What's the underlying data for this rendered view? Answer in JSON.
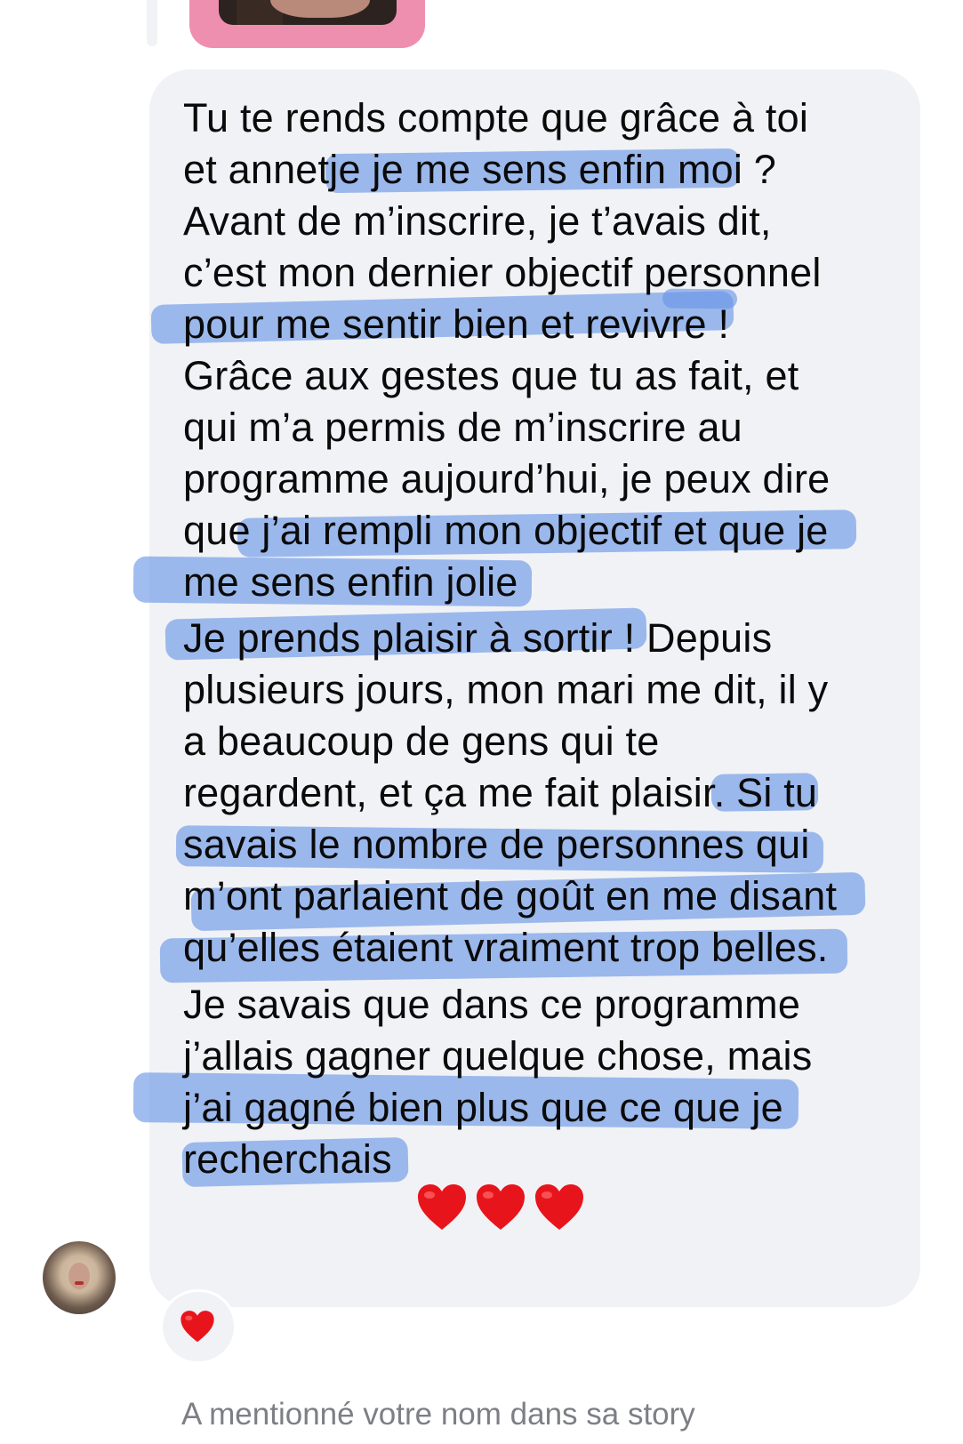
{
  "message": {
    "lines": [
      "Tu te rends compte que grâce à toi",
      "et annetje je me sens enfin moi ?",
      "Avant de m’inscrire, je t’avais dit,",
      "c’est mon dernier objectif personnel",
      "pour me sentir bien et revivre !",
      "Grâce aux gestes que tu as fait, et",
      "qui m’a permis de m’inscrire au",
      "programme aujourd’hui, je peux dire",
      "que j’ai rempli mon objectif et que je",
      "me sens enfin jolie",
      "Je prends plaisir à sortir ! Depuis",
      "plusieurs jours, mon mari me dit, il y",
      "a beaucoup de gens qui te",
      "regardent, et ça me fait plaisir. Si tu",
      "savais le nombre de personnes qui",
      "m’ont parlaient de goût en me disant",
      "qu’elles étaient vraiment trop belles.",
      "Je savais que dans ce programme",
      "j’allais gagner quelque chose, mais",
      "j’ai gagné bien plus que ce que je",
      "recherchais"
    ],
    "trailing_emoji": "heart-emoji",
    "trailing_emoji_count": 3,
    "highlight_color": "#6894e6"
  },
  "reaction": {
    "emoji": "heart-emoji"
  },
  "footer": {
    "story_mention": "A mentionné votre nom dans sa story"
  },
  "colors": {
    "bubble": "#f0f2f5",
    "story_frame": "#ee8fb0",
    "heart": "#e8141c",
    "footer_text": "#7d7f85"
  }
}
